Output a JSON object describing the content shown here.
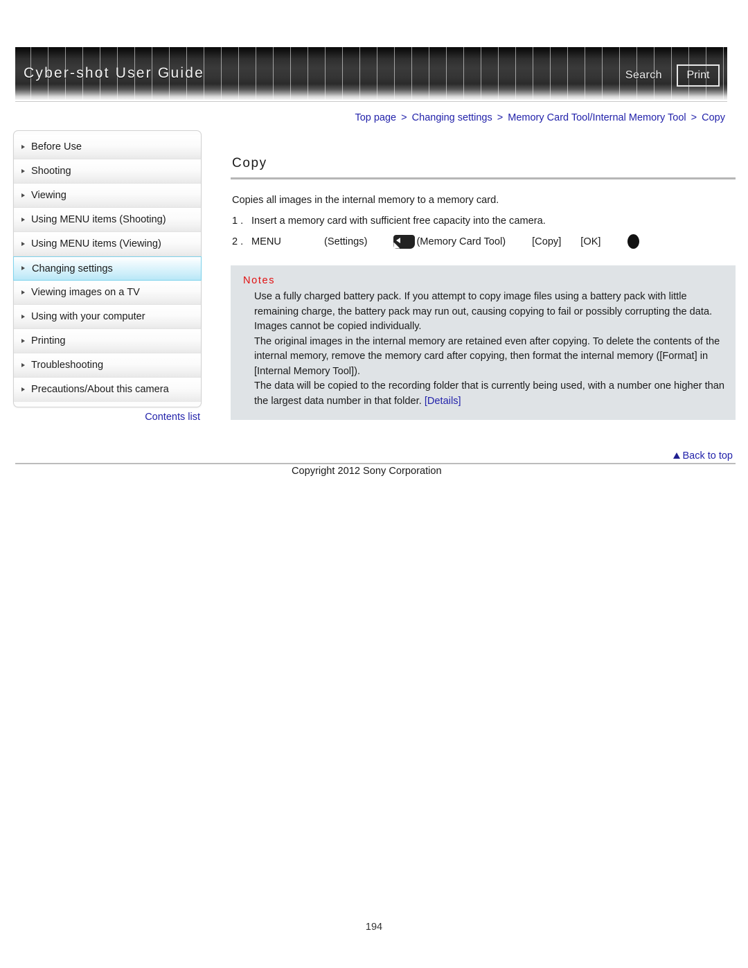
{
  "header": {
    "title": "Cyber-shot User Guide",
    "search_label": "Search",
    "print_label": "Print"
  },
  "breadcrumb": {
    "items": [
      {
        "label": "Top page"
      },
      {
        "label": "Changing settings"
      },
      {
        "label": "Memory Card Tool/Internal Memory Tool"
      },
      {
        "label": "Copy"
      }
    ],
    "separator": ">"
  },
  "sidebar": {
    "items": [
      {
        "label": "Before Use",
        "selected": false
      },
      {
        "label": "Shooting",
        "selected": false
      },
      {
        "label": "Viewing",
        "selected": false
      },
      {
        "label": "Using MENU items (Shooting)",
        "selected": false
      },
      {
        "label": "Using MENU items (Viewing)",
        "selected": false
      },
      {
        "label": "Changing settings",
        "selected": true
      },
      {
        "label": "Viewing images on a TV",
        "selected": false
      },
      {
        "label": "Using with your computer",
        "selected": false
      },
      {
        "label": "Printing",
        "selected": false
      },
      {
        "label": "Troubleshooting",
        "selected": false
      },
      {
        "label": "Precautions/About this camera",
        "selected": false
      }
    ],
    "contents_list_label": "Contents list"
  },
  "main": {
    "title": "Copy",
    "intro": "Copies all images in the internal memory to a memory card.",
    "steps": [
      {
        "num": "1 .",
        "text": "Insert a memory card with sufficient free capacity into the camera."
      },
      {
        "num": "2 .",
        "menu_label": "MENU",
        "settings_label": "(Settings)",
        "memory_card_tool_label": "(Memory Card Tool)",
        "copy_label": "[Copy]",
        "ok_label": "[OK]",
        "icons": {
          "memory_card_tool": "memory-card-tool-icon",
          "control_button": "control-button-icon"
        }
      }
    ]
  },
  "notes": {
    "heading": "Notes",
    "lines": [
      "Use a fully charged battery pack. If you attempt to copy image files using a battery pack with little remaining charge, the battery pack may run out, causing copying to fail or possibly corrupting the data.",
      "Images cannot be copied individually.",
      "The original images in the internal memory are retained even after copying. To delete the contents of the internal memory, remove the memory card after copying, then format the internal memory ([Format] in [Internal Memory Tool]).",
      "The data will be copied to the recording folder that is currently being used, with a number one higher than the largest data number in that folder. "
    ],
    "details_link": "[Details]"
  },
  "footer": {
    "back_to_top_label": "Back to top",
    "copyright": "Copyright 2012 Sony Corporation",
    "page_number": "194"
  },
  "colors": {
    "link": "#2222aa",
    "notes_heading": "#e01010",
    "notes_background": "#dfe3e6",
    "selected_nav_border": "#7fd3ec"
  }
}
